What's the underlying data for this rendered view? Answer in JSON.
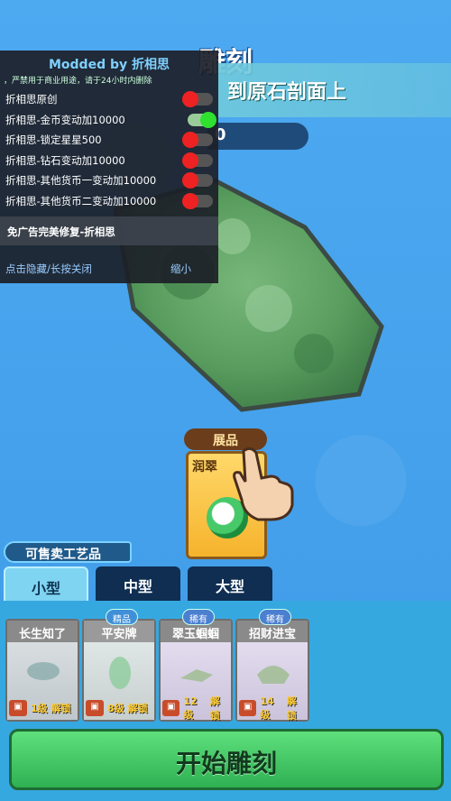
{
  "header": {
    "title": "雕刻",
    "banner_text": "到原石剖面上",
    "counter_value": "0"
  },
  "mod_menu": {
    "title": "Modded by 折相思",
    "subtitle": "，严禁用于商业用途，请于24小时内删除",
    "items": [
      {
        "label": "折相思原创",
        "state": "off"
      },
      {
        "label": "折相思-金币变动加10000",
        "state": "on"
      },
      {
        "label": "折相思-锁定星星500",
        "state": "off"
      },
      {
        "label": "折相思-钻石变动加10000",
        "state": "off"
      },
      {
        "label": "折相思-其他货币一变动加10000",
        "state": "off"
      },
      {
        "label": "折相思-其他货币二变动加10000",
        "state": "off"
      }
    ],
    "fix_label": "免广告完美修复-折相思",
    "footer_left": "点击隐藏/长按关闭",
    "footer_right": "缩小"
  },
  "showcase": {
    "label": "展品",
    "card_name": "润翠"
  },
  "section_label": "可售卖工艺品",
  "tabs": [
    {
      "label": "小型",
      "active": true
    },
    {
      "label": "中型"
    },
    {
      "label": "大型"
    }
  ],
  "items": [
    {
      "name": "长生知了",
      "tag": "",
      "level": "1级",
      "unlock": "解锁",
      "tone": "gray"
    },
    {
      "name": "平安牌",
      "tag": "精品",
      "level": "8级",
      "unlock": "解锁",
      "tone": "green"
    },
    {
      "name": "翠玉蝈蝈",
      "tag": "稀有",
      "level": "12级",
      "unlock": "解锁",
      "tone": "purple"
    },
    {
      "name": "招财进宝",
      "tag": "稀有",
      "level": "14级",
      "unlock": "解锁",
      "tone": "purple"
    }
  ],
  "start_button": "开始雕刻",
  "colors": {
    "on": "#2fe02f",
    "off": "#ee2222",
    "button": "#3fc363"
  }
}
